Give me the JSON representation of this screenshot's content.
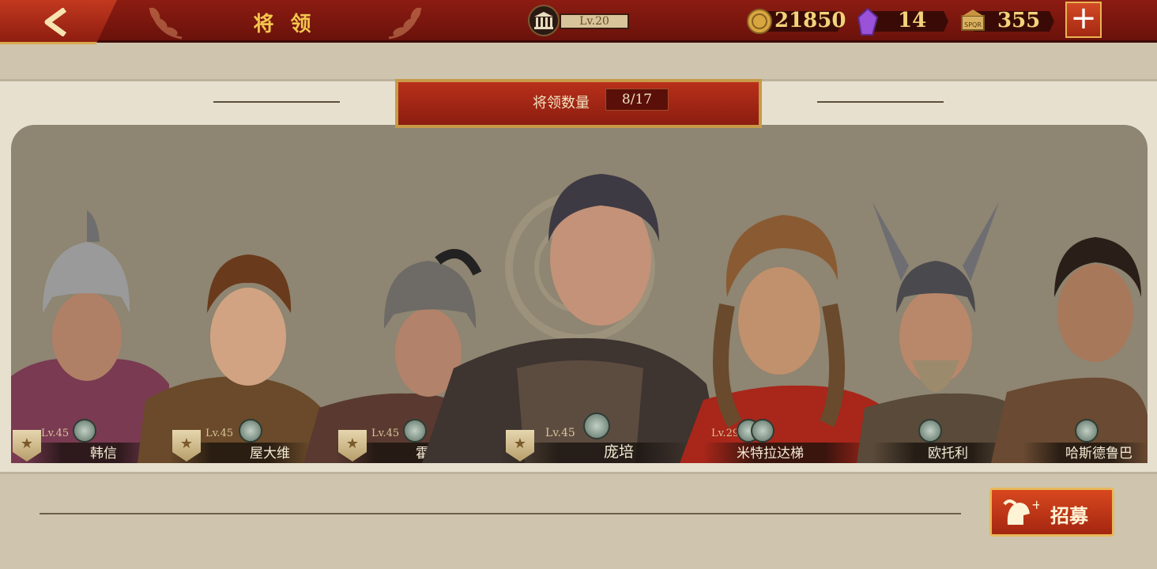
{
  "header": {
    "title": "将 领",
    "level_label": "Lv.20"
  },
  "resources": {
    "coins": "21850",
    "gems": "14",
    "spqr": "355",
    "spqr_icon_text": "SPQR"
  },
  "panel": {
    "count_label": "将领数量",
    "count_value": "8/17"
  },
  "generals": [
    {
      "name": "韩信",
      "level": "Lv.45"
    },
    {
      "name": "屋大维",
      "level": "Lv.45"
    },
    {
      "name": "霍",
      "level": "Lv.45"
    },
    {
      "name": "庞培",
      "level": "Lv.45"
    },
    {
      "name": "米特拉达梯",
      "level": "Lv.29"
    },
    {
      "name": "欧托利",
      "level": ""
    },
    {
      "name": "哈斯德鲁巴",
      "level": ""
    }
  ],
  "recruit": {
    "label": "招募"
  },
  "colors": {
    "topbar": "#7a170e",
    "gold": "#f3c64e",
    "panel": "#8e8572",
    "accent_red": "#b8301a"
  }
}
